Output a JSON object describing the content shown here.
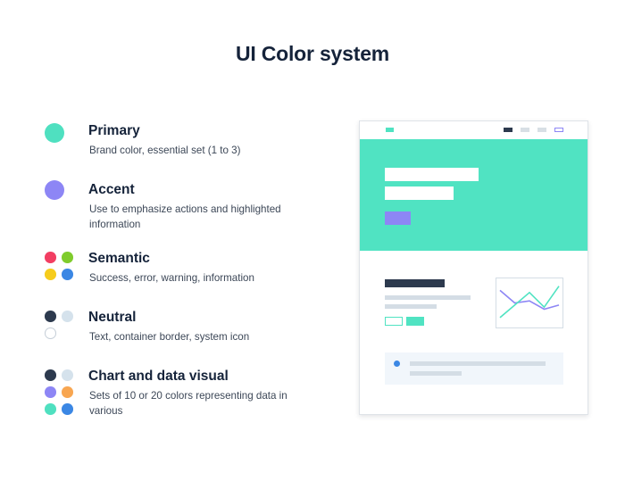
{
  "title": "UI Color system",
  "sections": [
    {
      "heading": "Primary",
      "description": "Brand color, essential set (1 to 3)",
      "swatches": [
        "#4fe0c0"
      ]
    },
    {
      "heading": "Accent",
      "description": "Use to emphasize actions and highlighted information",
      "swatches": [
        "#8d86f5"
      ]
    },
    {
      "heading": "Semantic",
      "description": "Success, error, warning, information",
      "swatches": [
        "#f23e62",
        "#7fcc2c",
        "#f6cc1c",
        "#3b87e4"
      ]
    },
    {
      "heading": "Neutral",
      "description": "Text, container border, system icon",
      "swatches": [
        "#2d3a4e",
        "#d5e2ec",
        "#ffffff"
      ]
    },
    {
      "heading": "Chart and data visual",
      "description": "Sets of 10 or 20 colors representing data in various",
      "swatches": [
        "#2d3a4e",
        "#d5e2ec",
        "#8d86f5",
        "#f8a651",
        "#4fe0c0",
        "#3b87e4"
      ]
    }
  ],
  "mockup": {
    "colors": {
      "primary": "#50e3c2",
      "accent": "#8d86f5",
      "dark": "#2d3a4e",
      "light_gray": "#d8dfe5",
      "line_gray": "#d4dde5",
      "card_bg": "#f1f6fb",
      "info_dot": "#3b87e4"
    },
    "chart_lines": {
      "teal": [
        0.85,
        0.55,
        0.25,
        0.6,
        0.1
      ],
      "purple": [
        0.2,
        0.5,
        0.45,
        0.65,
        0.55
      ]
    }
  }
}
